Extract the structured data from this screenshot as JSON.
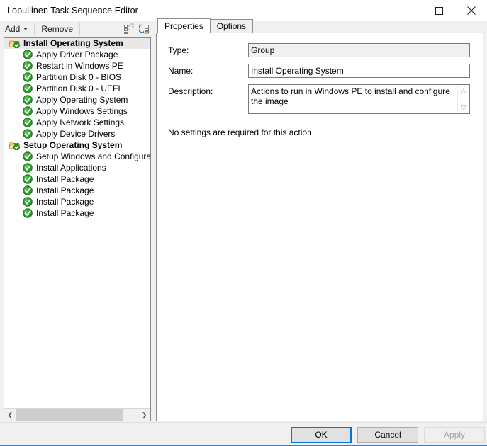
{
  "window": {
    "title": "Lopullinen Task Sequence Editor",
    "controls": {
      "minimize": "minimize-icon",
      "maximize": "maximize-icon",
      "close": "close-icon"
    }
  },
  "toolbar": {
    "add_label": "Add",
    "remove_label": "Remove",
    "icons": [
      {
        "name": "copy-list-icon"
      },
      {
        "name": "paste-list-icon"
      }
    ]
  },
  "tree": {
    "items": [
      {
        "label": "Install Operating System",
        "type": "group",
        "selected": true,
        "icon": "folder-check-icon"
      },
      {
        "label": "Apply Driver Package",
        "type": "step",
        "icon": "green-check-icon"
      },
      {
        "label": "Restart in Windows PE",
        "type": "step",
        "icon": "green-check-icon"
      },
      {
        "label": "Partition Disk 0 - BIOS",
        "type": "step",
        "icon": "green-check-icon"
      },
      {
        "label": "Partition Disk 0 - UEFI",
        "type": "step",
        "icon": "green-check-icon"
      },
      {
        "label": "Apply Operating System",
        "type": "step",
        "icon": "green-check-icon"
      },
      {
        "label": "Apply Windows Settings",
        "type": "step",
        "icon": "green-check-icon"
      },
      {
        "label": "Apply Network Settings",
        "type": "step",
        "icon": "green-check-icon"
      },
      {
        "label": "Apply Device Drivers",
        "type": "step",
        "icon": "green-check-icon"
      },
      {
        "label": "Setup Operating System",
        "type": "group",
        "selected": false,
        "icon": "folder-check-icon"
      },
      {
        "label": "Setup Windows and Configuration",
        "type": "step",
        "icon": "green-check-icon"
      },
      {
        "label": "Install Applications",
        "type": "step",
        "icon": "green-check-icon"
      },
      {
        "label": "Install Package",
        "type": "step",
        "icon": "green-check-icon"
      },
      {
        "label": "Install Package",
        "type": "step",
        "icon": "green-check-icon"
      },
      {
        "label": "Install Package",
        "type": "step",
        "icon": "green-check-icon"
      },
      {
        "label": "Install Package",
        "type": "step",
        "icon": "green-check-icon"
      }
    ],
    "scrollbar": {
      "left_arrow": "❮",
      "right_arrow": "❯"
    }
  },
  "tabs": [
    {
      "label": "Properties",
      "active": true
    },
    {
      "label": "Options",
      "active": false
    }
  ],
  "properties": {
    "type_label": "Type:",
    "type_value": "Group",
    "name_label": "Name:",
    "name_value": "Install Operating System",
    "description_label": "Description:",
    "description_value": "Actions to run in Windows PE to install and configure the image",
    "note": "No settings are required  for this action."
  },
  "footer": {
    "ok_label": "OK",
    "cancel_label": "Cancel",
    "apply_label": "Apply"
  },
  "colors": {
    "accent": "#0078d7",
    "check_green": "#29a02a",
    "folder_yellow": "#f0c862",
    "selection": "#e8e8e8"
  }
}
